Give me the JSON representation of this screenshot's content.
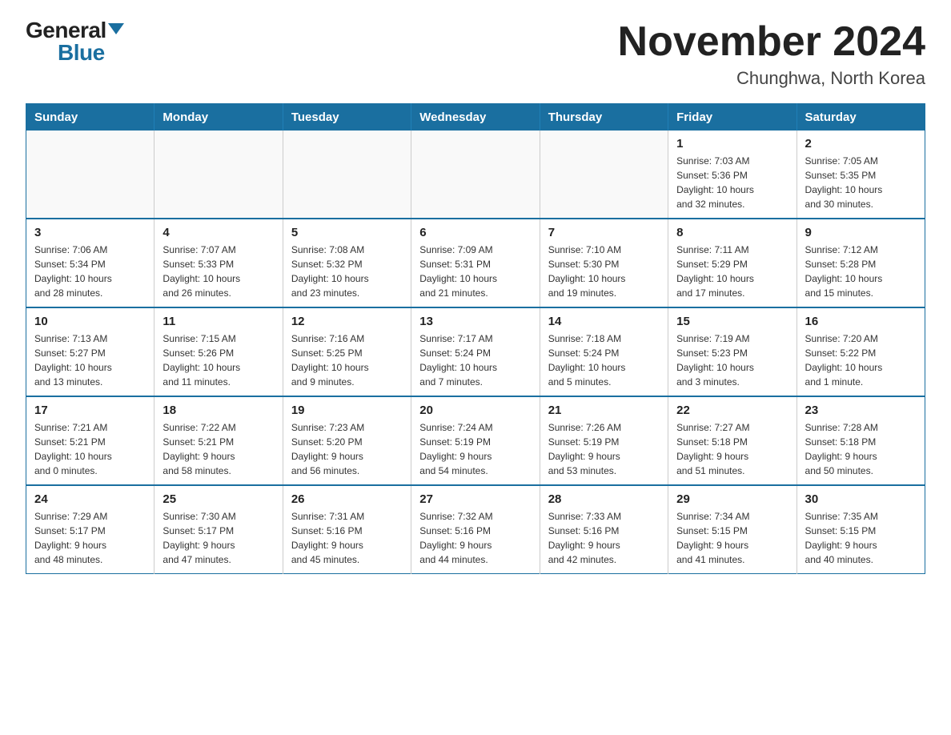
{
  "header": {
    "logo_general": "General",
    "logo_blue": "Blue",
    "month_title": "November 2024",
    "location": "Chunghwa, North Korea"
  },
  "weekdays": [
    "Sunday",
    "Monday",
    "Tuesday",
    "Wednesday",
    "Thursday",
    "Friday",
    "Saturday"
  ],
  "weeks": [
    [
      {
        "day": "",
        "info": ""
      },
      {
        "day": "",
        "info": ""
      },
      {
        "day": "",
        "info": ""
      },
      {
        "day": "",
        "info": ""
      },
      {
        "day": "",
        "info": ""
      },
      {
        "day": "1",
        "info": "Sunrise: 7:03 AM\nSunset: 5:36 PM\nDaylight: 10 hours\nand 32 minutes."
      },
      {
        "day": "2",
        "info": "Sunrise: 7:05 AM\nSunset: 5:35 PM\nDaylight: 10 hours\nand 30 minutes."
      }
    ],
    [
      {
        "day": "3",
        "info": "Sunrise: 7:06 AM\nSunset: 5:34 PM\nDaylight: 10 hours\nand 28 minutes."
      },
      {
        "day": "4",
        "info": "Sunrise: 7:07 AM\nSunset: 5:33 PM\nDaylight: 10 hours\nand 26 minutes."
      },
      {
        "day": "5",
        "info": "Sunrise: 7:08 AM\nSunset: 5:32 PM\nDaylight: 10 hours\nand 23 minutes."
      },
      {
        "day": "6",
        "info": "Sunrise: 7:09 AM\nSunset: 5:31 PM\nDaylight: 10 hours\nand 21 minutes."
      },
      {
        "day": "7",
        "info": "Sunrise: 7:10 AM\nSunset: 5:30 PM\nDaylight: 10 hours\nand 19 minutes."
      },
      {
        "day": "8",
        "info": "Sunrise: 7:11 AM\nSunset: 5:29 PM\nDaylight: 10 hours\nand 17 minutes."
      },
      {
        "day": "9",
        "info": "Sunrise: 7:12 AM\nSunset: 5:28 PM\nDaylight: 10 hours\nand 15 minutes."
      }
    ],
    [
      {
        "day": "10",
        "info": "Sunrise: 7:13 AM\nSunset: 5:27 PM\nDaylight: 10 hours\nand 13 minutes."
      },
      {
        "day": "11",
        "info": "Sunrise: 7:15 AM\nSunset: 5:26 PM\nDaylight: 10 hours\nand 11 minutes."
      },
      {
        "day": "12",
        "info": "Sunrise: 7:16 AM\nSunset: 5:25 PM\nDaylight: 10 hours\nand 9 minutes."
      },
      {
        "day": "13",
        "info": "Sunrise: 7:17 AM\nSunset: 5:24 PM\nDaylight: 10 hours\nand 7 minutes."
      },
      {
        "day": "14",
        "info": "Sunrise: 7:18 AM\nSunset: 5:24 PM\nDaylight: 10 hours\nand 5 minutes."
      },
      {
        "day": "15",
        "info": "Sunrise: 7:19 AM\nSunset: 5:23 PM\nDaylight: 10 hours\nand 3 minutes."
      },
      {
        "day": "16",
        "info": "Sunrise: 7:20 AM\nSunset: 5:22 PM\nDaylight: 10 hours\nand 1 minute."
      }
    ],
    [
      {
        "day": "17",
        "info": "Sunrise: 7:21 AM\nSunset: 5:21 PM\nDaylight: 10 hours\nand 0 minutes."
      },
      {
        "day": "18",
        "info": "Sunrise: 7:22 AM\nSunset: 5:21 PM\nDaylight: 9 hours\nand 58 minutes."
      },
      {
        "day": "19",
        "info": "Sunrise: 7:23 AM\nSunset: 5:20 PM\nDaylight: 9 hours\nand 56 minutes."
      },
      {
        "day": "20",
        "info": "Sunrise: 7:24 AM\nSunset: 5:19 PM\nDaylight: 9 hours\nand 54 minutes."
      },
      {
        "day": "21",
        "info": "Sunrise: 7:26 AM\nSunset: 5:19 PM\nDaylight: 9 hours\nand 53 minutes."
      },
      {
        "day": "22",
        "info": "Sunrise: 7:27 AM\nSunset: 5:18 PM\nDaylight: 9 hours\nand 51 minutes."
      },
      {
        "day": "23",
        "info": "Sunrise: 7:28 AM\nSunset: 5:18 PM\nDaylight: 9 hours\nand 50 minutes."
      }
    ],
    [
      {
        "day": "24",
        "info": "Sunrise: 7:29 AM\nSunset: 5:17 PM\nDaylight: 9 hours\nand 48 minutes."
      },
      {
        "day": "25",
        "info": "Sunrise: 7:30 AM\nSunset: 5:17 PM\nDaylight: 9 hours\nand 47 minutes."
      },
      {
        "day": "26",
        "info": "Sunrise: 7:31 AM\nSunset: 5:16 PM\nDaylight: 9 hours\nand 45 minutes."
      },
      {
        "day": "27",
        "info": "Sunrise: 7:32 AM\nSunset: 5:16 PM\nDaylight: 9 hours\nand 44 minutes."
      },
      {
        "day": "28",
        "info": "Sunrise: 7:33 AM\nSunset: 5:16 PM\nDaylight: 9 hours\nand 42 minutes."
      },
      {
        "day": "29",
        "info": "Sunrise: 7:34 AM\nSunset: 5:15 PM\nDaylight: 9 hours\nand 41 minutes."
      },
      {
        "day": "30",
        "info": "Sunrise: 7:35 AM\nSunset: 5:15 PM\nDaylight: 9 hours\nand 40 minutes."
      }
    ]
  ]
}
